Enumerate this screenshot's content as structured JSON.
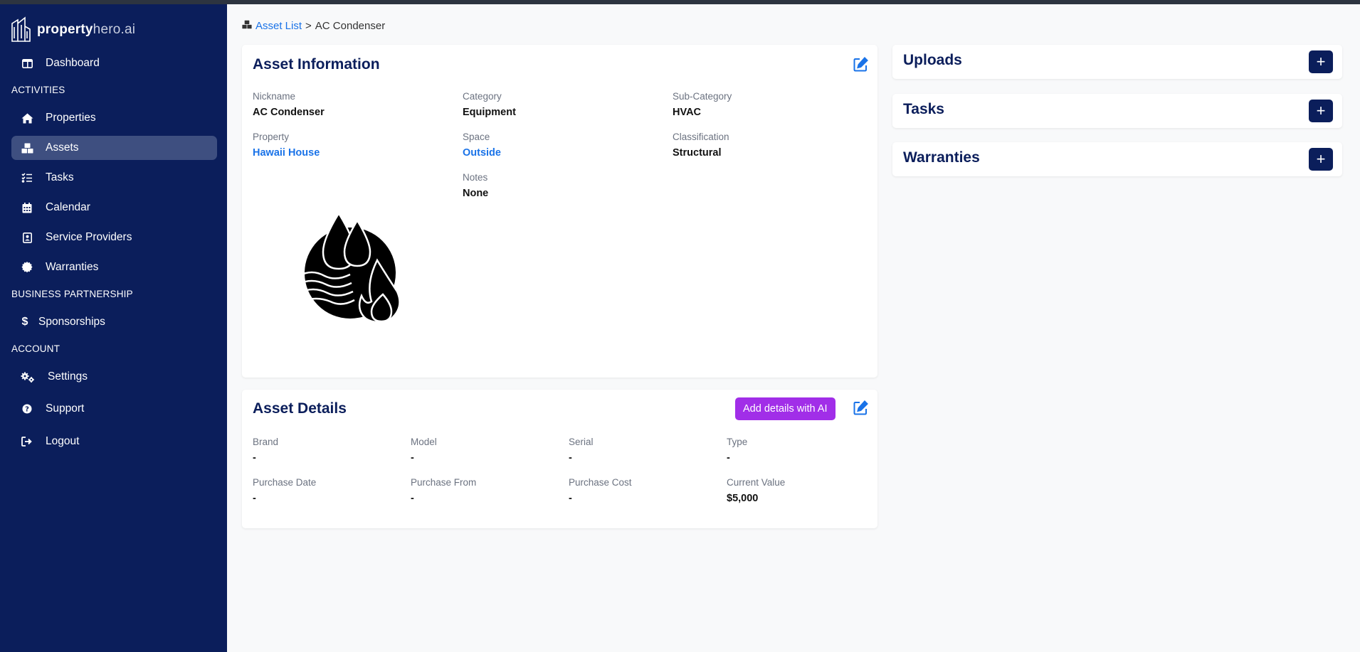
{
  "app": {
    "logo_main": "property",
    "logo_accent": "hero.ai"
  },
  "sidebar": {
    "items": [
      {
        "label": "Dashboard",
        "icon": "dashboard-icon"
      },
      {
        "label": "Properties",
        "icon": "home-icon"
      },
      {
        "label": "Assets",
        "icon": "boxes-icon",
        "active": true
      },
      {
        "label": "Tasks",
        "icon": "list-check-icon"
      },
      {
        "label": "Calendar",
        "icon": "calendar-icon"
      },
      {
        "label": "Service Providers",
        "icon": "contact-card-icon"
      },
      {
        "label": "Warranties",
        "icon": "badge-icon"
      },
      {
        "label": "Sponsorships",
        "icon": "dollar-icon"
      },
      {
        "label": "Settings",
        "icon": "gears-icon"
      },
      {
        "label": "Support",
        "icon": "question-icon"
      },
      {
        "label": "Logout",
        "icon": "logout-icon"
      }
    ],
    "sections": {
      "activities": "ACTIVITIES",
      "business": "BUSINESS PARTNERSHIP",
      "account": "ACCOUNT"
    }
  },
  "breadcrumb": {
    "parent": "Asset List",
    "separator": ">",
    "current": "AC Condenser"
  },
  "asset_info": {
    "title": "Asset Information",
    "fields": [
      {
        "label": "Nickname",
        "value": "AC Condenser"
      },
      {
        "label": "Category",
        "value": "Equipment"
      },
      {
        "label": "Sub-Category",
        "value": "HVAC"
      },
      {
        "label": "Property",
        "value": "Hawaii House"
      },
      {
        "label": "Space",
        "value": "Outside"
      },
      {
        "label": "Classification",
        "value": "Structural"
      },
      {
        "label": "Notes",
        "value": "None"
      }
    ],
    "image_icon": "hvac-icon"
  },
  "asset_details": {
    "title": "Asset Details",
    "ai_button": "Add details with AI",
    "fields": [
      {
        "label": "Brand",
        "value": "-"
      },
      {
        "label": "Model",
        "value": "-"
      },
      {
        "label": "Serial",
        "value": "-"
      },
      {
        "label": "Type",
        "value": "-"
      },
      {
        "label": "Purchase Date",
        "value": "-"
      },
      {
        "label": "Purchase From",
        "value": "-"
      },
      {
        "label": "Purchase Cost",
        "value": "-"
      },
      {
        "label": "Current Value",
        "value": "$5,000"
      }
    ]
  },
  "side_panels": [
    {
      "title": "Uploads"
    },
    {
      "title": "Tasks"
    },
    {
      "title": "Warranties"
    }
  ],
  "colors": {
    "sidebar": "#0b1e5b",
    "accent": "#1a73e8",
    "ai": "#a12ee8"
  }
}
